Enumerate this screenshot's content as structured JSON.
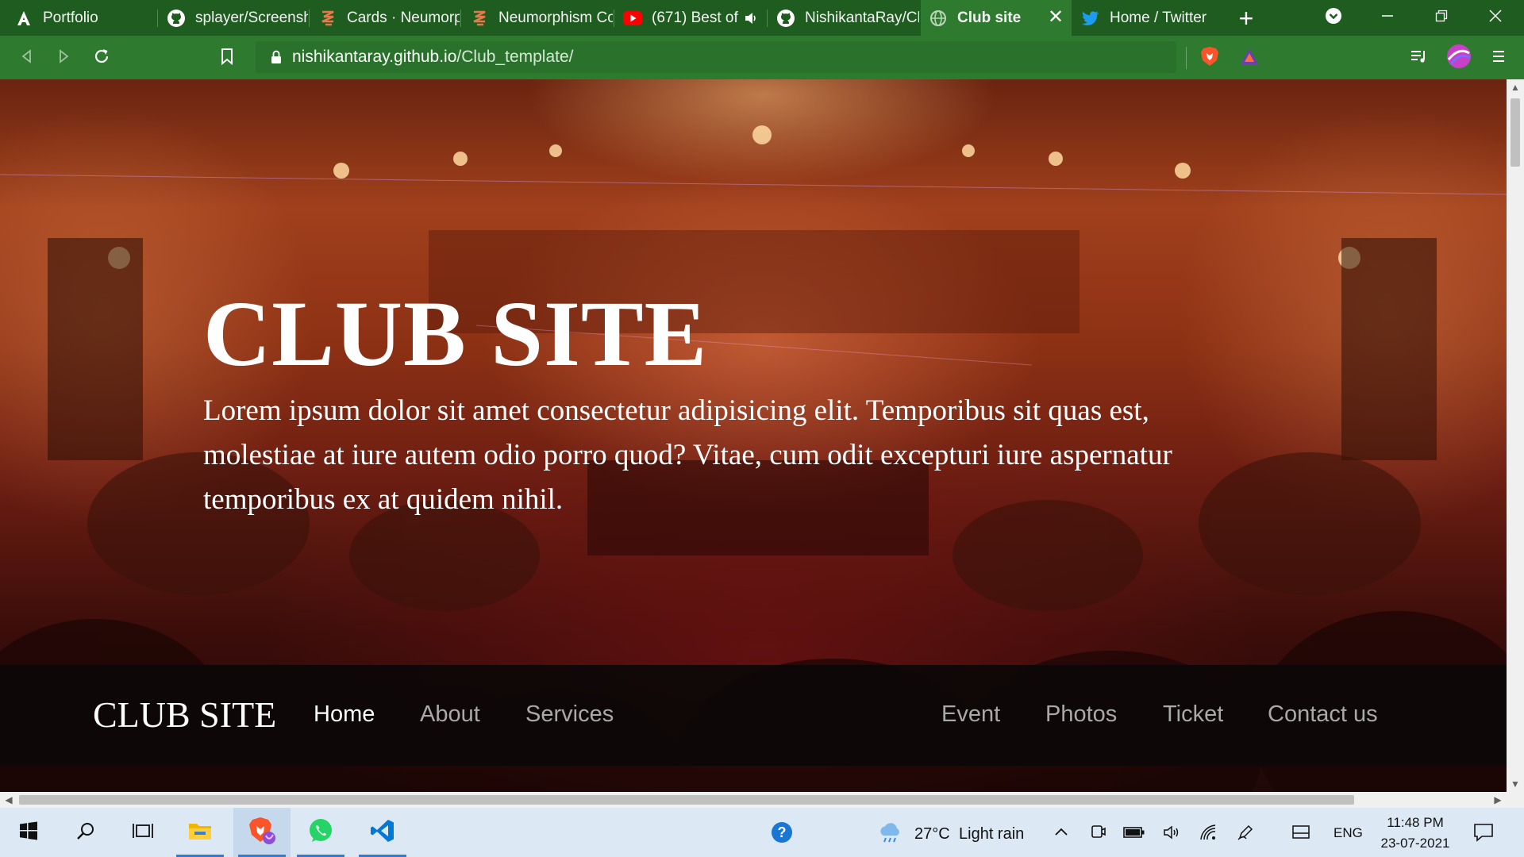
{
  "browser": {
    "tabs": [
      {
        "label": "Portfolio",
        "icon": "a-logo-icon",
        "active": false
      },
      {
        "label": "splayer/Screensh",
        "icon": "github-icon",
        "active": false
      },
      {
        "label": "Cards · Neumorp",
        "icon": "codepen-style-icon",
        "active": false
      },
      {
        "label": "Neumorphism Co",
        "icon": "codepen-style-icon",
        "active": false
      },
      {
        "label": "(671) Best of",
        "icon": "youtube-icon",
        "active": false
      },
      {
        "label": "NishikantaRay/Cl",
        "icon": "github-icon",
        "active": false
      },
      {
        "label": "Club site",
        "icon": "globe-icon",
        "active": true
      },
      {
        "label": "Home / Twitter",
        "icon": "twitter-icon",
        "active": false
      }
    ],
    "close_glyph": "✕",
    "new_tab_glyph": "+",
    "address": {
      "host": "nishikantaray.github.io",
      "path": "/Club_template/"
    }
  },
  "page": {
    "hero_title": "CLUB SITE",
    "hero_text": "Lorem ipsum dolor sit amet consectetur adipisicing elit. Temporibus sit quas est, molestiae at iure autem odio porro quod? Vitae, cum odit excepturi iure aspernatur temporibus ex at quidem nihil.",
    "nav": {
      "brand": "CLUB SITE",
      "left_links": [
        "Home",
        "About",
        "Services"
      ],
      "right_links": [
        "Event",
        "Photos",
        "Ticket",
        "Contact us"
      ],
      "active": "Home"
    }
  },
  "taskbar": {
    "weather": {
      "temp": "27°C",
      "condition": "Light rain"
    },
    "language": "ENG",
    "time": "11:48 PM",
    "date": "23-07-2021"
  },
  "colors": {
    "browser_frame": "#1f5c20",
    "browser_toolbar": "#2e7a2f",
    "nav_active": "#ffffff",
    "nav_inactive": "#a9a9a9",
    "taskbar": "#dce8f3"
  }
}
